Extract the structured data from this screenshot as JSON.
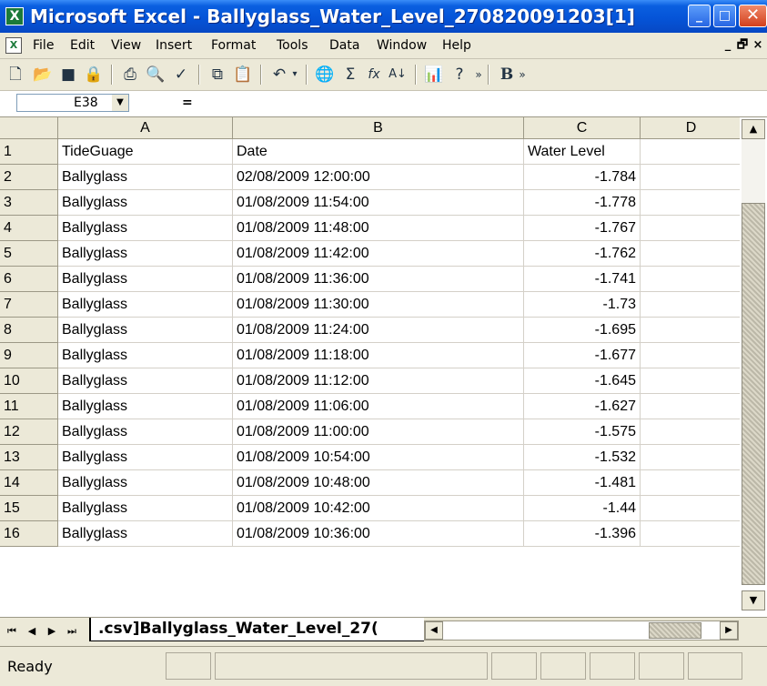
{
  "window": {
    "title": "Microsoft Excel - Ballyglass_Water_Level_270820091203[1]",
    "minimize_glyph": "_",
    "maximize_glyph": "□",
    "close_glyph": "✕"
  },
  "menubar": {
    "items": [
      "File",
      "Edit",
      "View",
      "Insert",
      "Format",
      "Tools",
      "Data",
      "Window",
      "Help"
    ],
    "doc_minimize_glyph": "_",
    "doc_restore_glyph": "🗗",
    "doc_close_glyph": "×"
  },
  "toolbar": {
    "icons": [
      "new-icon",
      "open-icon",
      "save-icon",
      "permission-icon",
      "print-icon",
      "print-preview-icon",
      "spelling-icon",
      "copy-icon",
      "paste-icon",
      "undo-icon",
      "hyperlink-icon",
      "autosum-icon",
      "function-icon",
      "sort-ascending-icon",
      "chart-wizard-icon",
      "help-icon",
      "toolbar-options-icon",
      "bold-icon"
    ]
  },
  "formula_bar": {
    "name_box": "E38",
    "equals": "=",
    "formula": ""
  },
  "grid": {
    "columns": [
      "A",
      "B",
      "C",
      "D"
    ],
    "rows": [
      {
        "num": "1",
        "a": "TideGuage",
        "b": "Date",
        "c": "Water Level"
      },
      {
        "num": "2",
        "a": "Ballyglass",
        "b": "02/08/2009 12:00:00",
        "c": "-1.784"
      },
      {
        "num": "3",
        "a": "Ballyglass",
        "b": "01/08/2009 11:54:00",
        "c": "-1.778"
      },
      {
        "num": "4",
        "a": "Ballyglass",
        "b": "01/08/2009 11:48:00",
        "c": "-1.767"
      },
      {
        "num": "5",
        "a": "Ballyglass",
        "b": "01/08/2009 11:42:00",
        "c": "-1.762"
      },
      {
        "num": "6",
        "a": "Ballyglass",
        "b": "01/08/2009 11:36:00",
        "c": "-1.741"
      },
      {
        "num": "7",
        "a": "Ballyglass",
        "b": "01/08/2009 11:30:00",
        "c": "-1.73"
      },
      {
        "num": "8",
        "a": "Ballyglass",
        "b": "01/08/2009 11:24:00",
        "c": "-1.695"
      },
      {
        "num": "9",
        "a": "Ballyglass",
        "b": "01/08/2009 11:18:00",
        "c": "-1.677"
      },
      {
        "num": "10",
        "a": "Ballyglass",
        "b": "01/08/2009 11:12:00",
        "c": "-1.645"
      },
      {
        "num": "11",
        "a": "Ballyglass",
        "b": "01/08/2009 11:06:00",
        "c": "-1.627"
      },
      {
        "num": "12",
        "a": "Ballyglass",
        "b": "01/08/2009 11:00:00",
        "c": "-1.575"
      },
      {
        "num": "13",
        "a": "Ballyglass",
        "b": "01/08/2009 10:54:00",
        "c": "-1.532"
      },
      {
        "num": "14",
        "a": "Ballyglass",
        "b": "01/08/2009 10:48:00",
        "c": "-1.481"
      },
      {
        "num": "15",
        "a": "Ballyglass",
        "b": "01/08/2009 10:42:00",
        "c": "-1.44"
      },
      {
        "num": "16",
        "a": "Ballyglass",
        "b": "01/08/2009 10:36:00",
        "c": "-1.396"
      }
    ]
  },
  "sheet_tabs": {
    "active": ".csv]Ballyglass_Water_Level_27("
  },
  "status": {
    "text": "Ready"
  }
}
